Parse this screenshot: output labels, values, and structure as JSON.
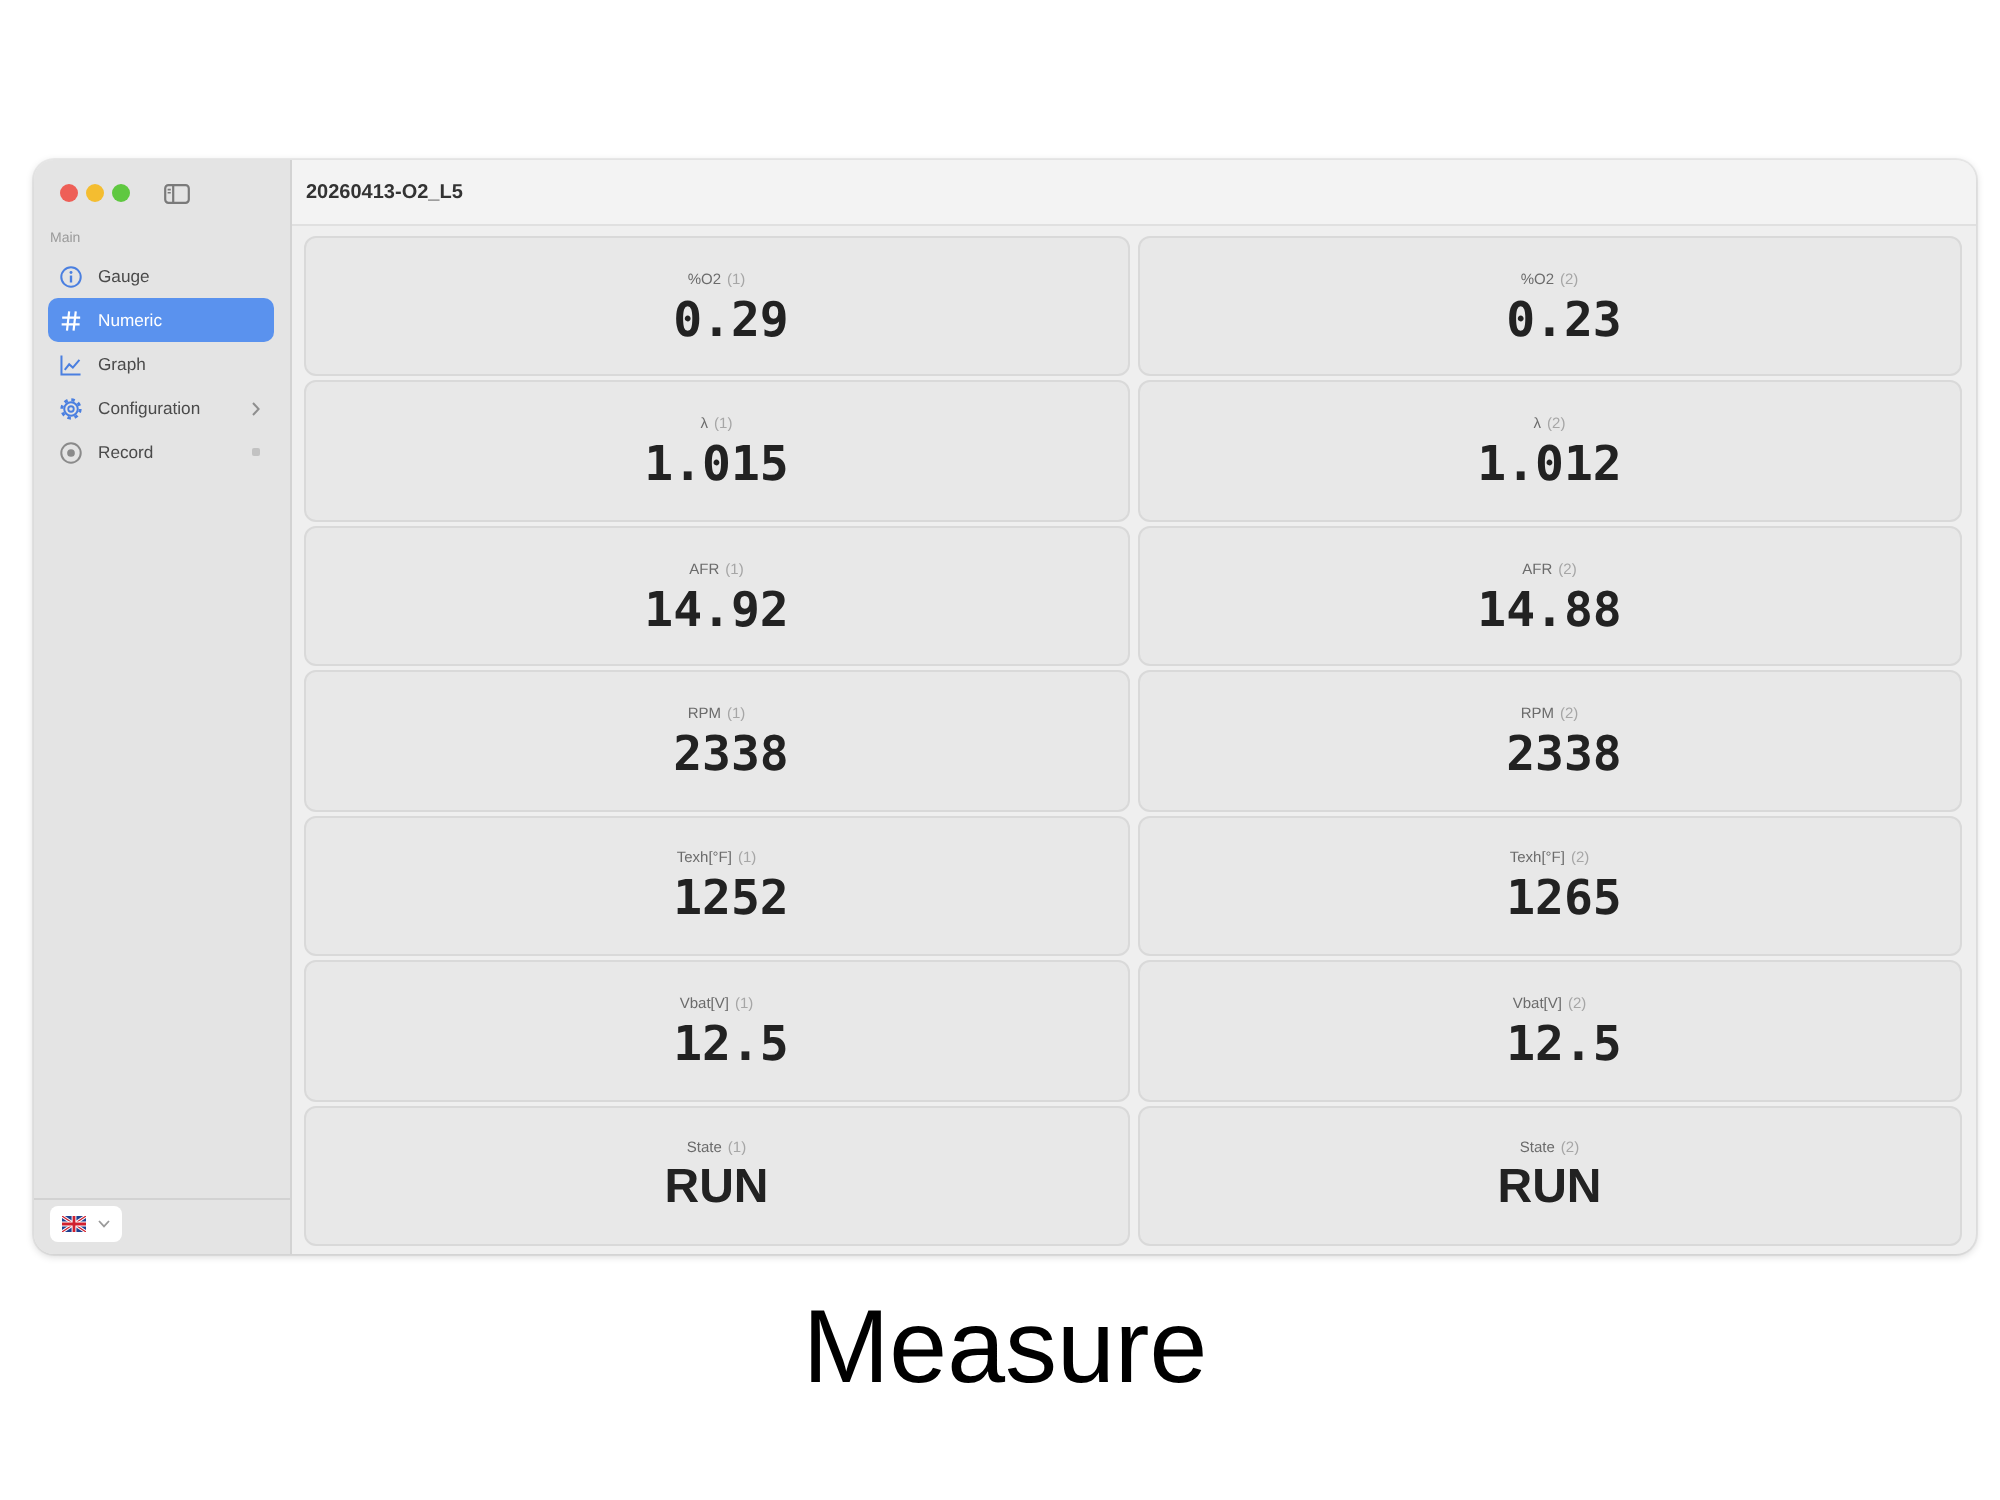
{
  "sidebar": {
    "section": "Main",
    "items": [
      {
        "label": "Gauge",
        "selected": false,
        "kind": "page"
      },
      {
        "label": "Numeric",
        "selected": true,
        "kind": "page"
      },
      {
        "label": "Graph",
        "selected": false,
        "kind": "page"
      },
      {
        "label": "Configuration",
        "selected": false,
        "kind": "group"
      },
      {
        "label": "Record",
        "selected": false,
        "kind": "recorder"
      }
    ]
  },
  "title": "20260413-O2_L5",
  "readings": [
    {
      "label": "%O2",
      "channel": "(1)",
      "value": "0.29",
      "kind": "number"
    },
    {
      "label": "%O2",
      "channel": "(2)",
      "value": "0.23",
      "kind": "number"
    },
    {
      "label": "λ",
      "channel": "(1)",
      "value": "1.015",
      "kind": "number"
    },
    {
      "label": "λ",
      "channel": "(2)",
      "value": "1.012",
      "kind": "number"
    },
    {
      "label": "AFR",
      "channel": "(1)",
      "value": "14.92",
      "kind": "number"
    },
    {
      "label": "AFR",
      "channel": "(2)",
      "value": "14.88",
      "kind": "number"
    },
    {
      "label": "RPM",
      "channel": "(1)",
      "value": "2338",
      "kind": "number"
    },
    {
      "label": "RPM",
      "channel": "(2)",
      "value": "2338",
      "kind": "number"
    },
    {
      "label": "Texh[°F]",
      "channel": "(1)",
      "value": "1252",
      "kind": "number"
    },
    {
      "label": "Texh[°F]",
      "channel": "(2)",
      "value": "1265",
      "kind": "number"
    },
    {
      "label": "Vbat[V]",
      "channel": "(1)",
      "value": "12.5",
      "kind": "number"
    },
    {
      "label": "Vbat[V]",
      "channel": "(2)",
      "value": "12.5",
      "kind": "number"
    },
    {
      "label": "State",
      "channel": "(1)",
      "value": "RUN",
      "kind": "text"
    },
    {
      "label": "State",
      "channel": "(2)",
      "value": "RUN",
      "kind": "text"
    }
  ],
  "caption": "Measure"
}
